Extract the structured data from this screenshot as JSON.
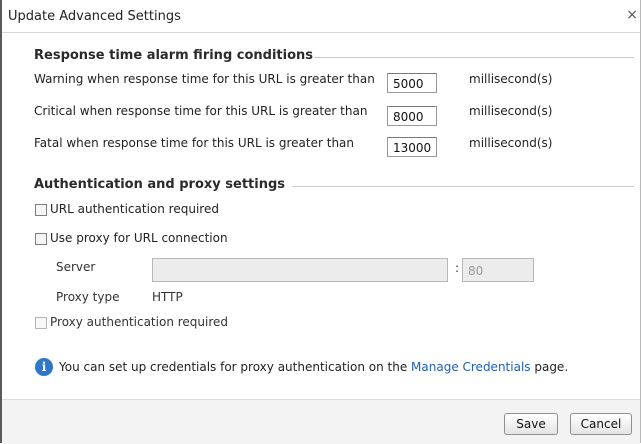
{
  "window": {
    "title": "Update Advanced Settings",
    "close_label": "×"
  },
  "response_section": {
    "title": "Response time alarm firing conditions",
    "rows": [
      {
        "label": "Warning when response time for this URL is greater than",
        "value": "5000",
        "unit": "millisecond(s)"
      },
      {
        "label": "Critical when response time for this URL is greater than",
        "value": "8000",
        "unit": "millisecond(s)"
      },
      {
        "label": "Fatal when response time for this URL is greater than",
        "value": "13000",
        "unit": "millisecond(s)"
      }
    ]
  },
  "auth_section": {
    "title": "Authentication and proxy settings",
    "url_auth_label": "URL authentication required",
    "use_proxy_label": "Use proxy for URL connection",
    "server_label": "Server",
    "server_value": "",
    "port_separator": ":",
    "port_value": "80",
    "proxy_type_label": "Proxy type",
    "proxy_type_value": "HTTP",
    "proxy_auth_label": "Proxy authentication required"
  },
  "info": {
    "icon": "info-icon",
    "text_before": "You can set up credentials for proxy authentication on the ",
    "link": "Manage Credentials",
    "text_after": " page."
  },
  "footer": {
    "save_label": "Save",
    "cancel_label": "Cancel"
  }
}
